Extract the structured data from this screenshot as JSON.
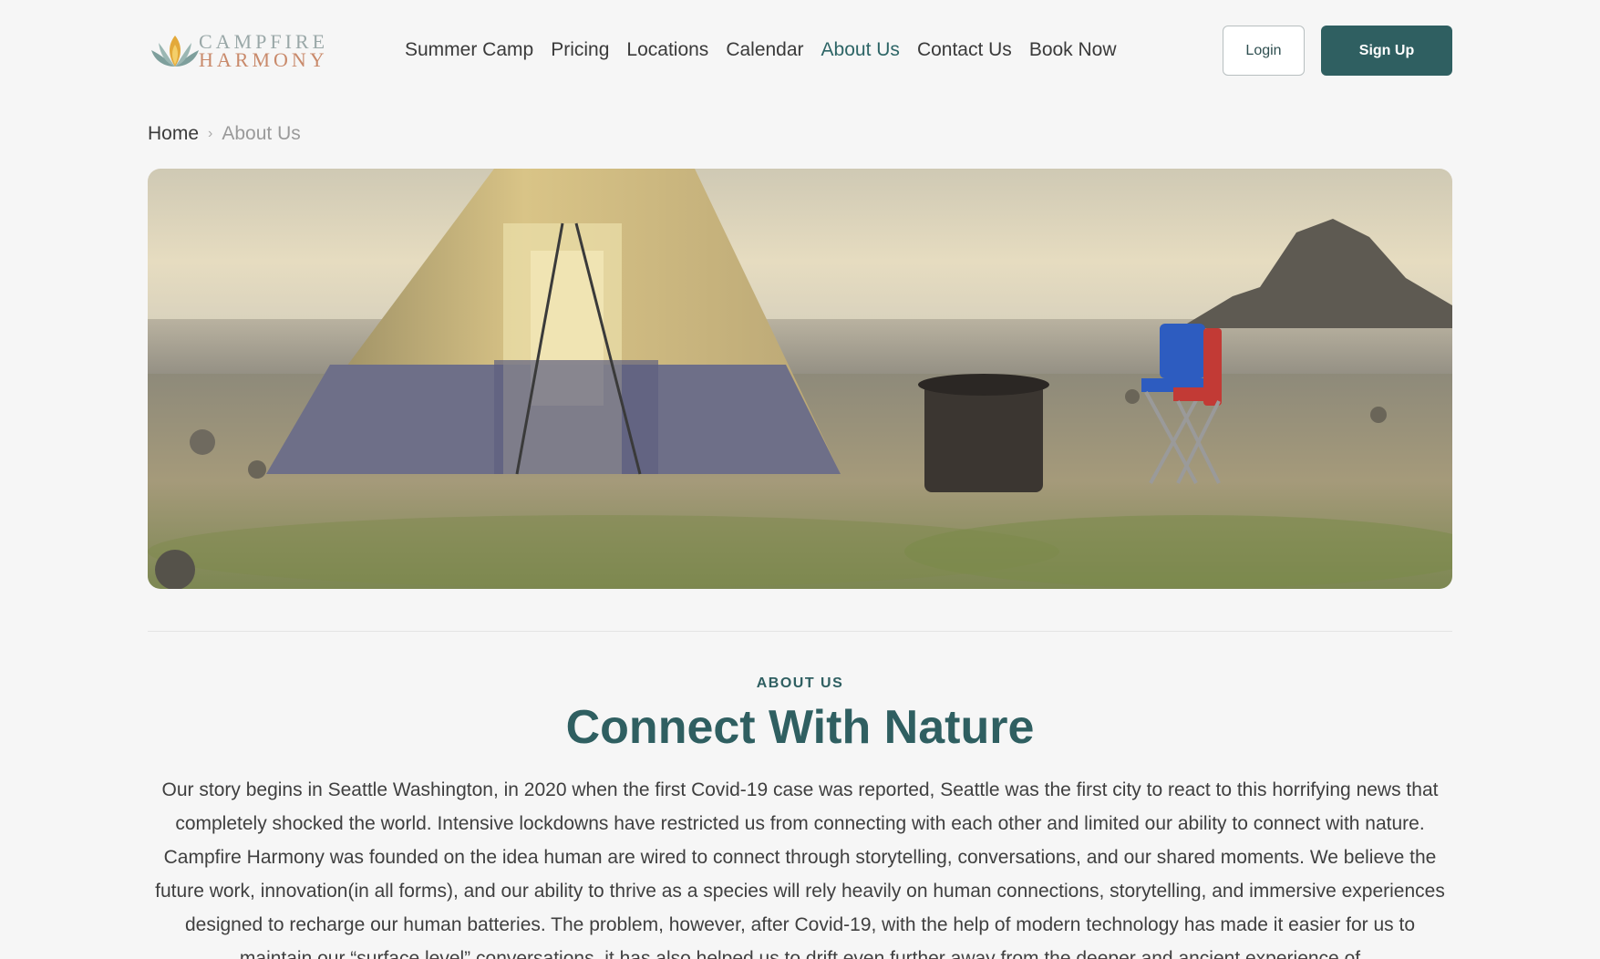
{
  "brand": {
    "line1": "CAMPFIRE",
    "line2": "HARMONY",
    "colors": {
      "primary": "#2f5f61",
      "accent": "#c98a6b",
      "flame": "#e3a93a"
    }
  },
  "nav": {
    "items": [
      {
        "label": "Summer Camp",
        "active": false
      },
      {
        "label": "Pricing",
        "active": false
      },
      {
        "label": "Locations",
        "active": false
      },
      {
        "label": "Calendar",
        "active": false
      },
      {
        "label": "About Us",
        "active": true
      },
      {
        "label": "Contact Us",
        "active": false
      },
      {
        "label": "Book Now",
        "active": false
      }
    ],
    "login_label": "Login",
    "signup_label": "Sign Up"
  },
  "breadcrumb": {
    "home": "Home",
    "separator_icon": "chevron-right-icon",
    "current": "About Us"
  },
  "about": {
    "eyebrow": "ABOUT US",
    "title": "Connect With Nature",
    "body": "Our story begins in Seattle Washington, in 2020 when the first Covid-19 case was reported, Seattle was the first city to react to this horrifying news that completely shocked the world. Intensive lockdowns have restricted us from connecting with each other and limited our ability to connect with nature.  Campfire Harmony was founded on the idea human are wired to connect through storytelling, conversations, and our shared moments. We believe the future work, innovation(in all forms), and our ability to thrive as a species will rely heavily on human connections, storytelling, and immersive experiences designed to recharge our human batteries. The problem, however, after Covid-19, with the help of modern technology has made it easier for us to maintain our “surface level” conversations, it has also helped us to drift even further away from the deeper and ancient experience of"
  }
}
